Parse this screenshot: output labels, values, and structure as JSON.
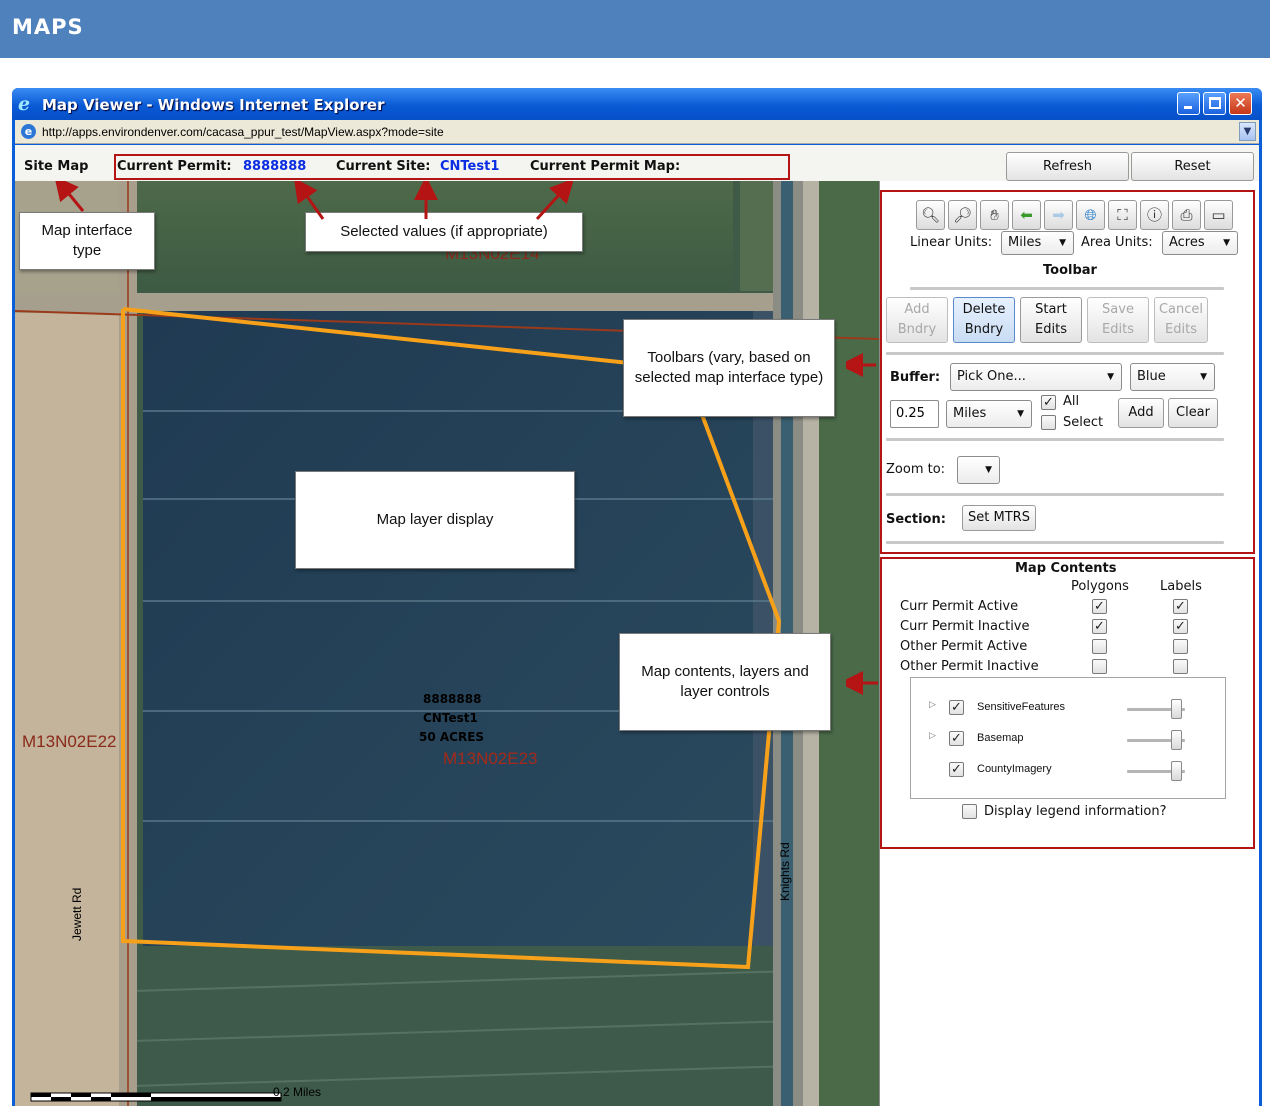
{
  "banner": {
    "title": "MAPS"
  },
  "browser": {
    "title": "Map Viewer - Windows Internet Explorer",
    "logo_glyph": "e",
    "url": "http://apps.environdenver.com/cacasa_ppur_test/MapView.aspx?mode=site",
    "close_glyph": "✕"
  },
  "info_bar": {
    "map_type": "Site Map",
    "permit_label": "Current Permit:",
    "permit_value": "8888888",
    "site_label": "Current Site:",
    "site_value": "CNTest1",
    "permit_map_label": "Current Permit Map:",
    "refresh": "Refresh",
    "reset": "Reset"
  },
  "map": {
    "section_top": "M13N02E14",
    "section_left": "M13N02E22",
    "section_center": "M13N02E23",
    "parcel_permit": "8888888",
    "parcel_site": "CNTest1",
    "parcel_area": "50 ACRES",
    "road_left": "Jewett Rd",
    "road_right": "Knights Rd",
    "scale_label": "0.2 Miles"
  },
  "callouts": {
    "interface_type": "Map interface type",
    "selected_values": "Selected values (if appropriate)",
    "toolbars": "Toolbars (vary, based on selected map interface type)",
    "layer_display": "Map layer display",
    "map_contents": "Map contents, layers and layer controls"
  },
  "toolbar": {
    "tools": [
      {
        "name": "zoom-in-icon",
        "glyph": "🔍︎"
      },
      {
        "name": "zoom-out-icon",
        "glyph": "🔎︎"
      },
      {
        "name": "pan-hand-icon",
        "glyph": "✋︎"
      },
      {
        "name": "back-arrow-icon",
        "glyph": "⬅"
      },
      {
        "name": "forward-arrow-icon",
        "glyph": "➡"
      },
      {
        "name": "full-extent-globe-icon",
        "glyph": "🌐︎"
      },
      {
        "name": "zoom-extent-icon",
        "glyph": "⛶"
      },
      {
        "name": "identify-icon",
        "glyph": "ⓘ"
      },
      {
        "name": "print-icon",
        "glyph": "⎙"
      },
      {
        "name": "clear-selection-icon",
        "glyph": "▭"
      }
    ],
    "linear_units_label": "Linear Units:",
    "linear_units_value": "Miles",
    "area_units_label": "Area Units:",
    "area_units_value": "Acres",
    "heading": "Toolbar",
    "edit_buttons": {
      "add_1": "Add",
      "add_2": "Bndry",
      "delete_1": "Delete",
      "delete_2": "Bndry",
      "start_1": "Start",
      "start_2": "Edits",
      "save_1": "Save",
      "save_2": "Edits",
      "cancel_1": "Cancel",
      "cancel_2": "Edits"
    },
    "buffer_label": "Buffer:",
    "buffer_pick": "Pick One...",
    "buffer_color": "Blue",
    "buffer_distance": "0.25",
    "buffer_units": "Miles",
    "all_label": "All",
    "select_label": "Select",
    "add": "Add",
    "clear": "Clear",
    "zoom_to_label": "Zoom to:",
    "section_label": "Section:",
    "set_mtrs": "Set MTRS"
  },
  "map_contents": {
    "title": "Map Contents",
    "col_polygons": "Polygons",
    "col_labels": "Labels",
    "rows": [
      {
        "label": "Curr Permit Active",
        "poly": "✓",
        "labels": "✓"
      },
      {
        "label": "Curr Permit Inactive",
        "poly": "✓",
        "labels": "✓"
      },
      {
        "label": "Other Permit Active",
        "poly": "",
        "labels": ""
      },
      {
        "label": "Other Permit Inactive",
        "poly": "",
        "labels": ""
      }
    ],
    "layers": [
      {
        "label": "SensitiveFeatures",
        "check": "✓",
        "expand": "▷",
        "opacity": 1.0
      },
      {
        "label": "Basemap",
        "check": "✓",
        "expand": "▷",
        "opacity": 1.0
      },
      {
        "label": "CountyImagery",
        "check": "✓",
        "expand": "",
        "opacity": 1.0
      }
    ],
    "legend_label": "Display legend information?"
  },
  "colors": {
    "banner": "#4f81bd",
    "annotation_red": "#b41414",
    "parcel_outline": "#f7a11a",
    "link_blue": "#0a2de3"
  }
}
